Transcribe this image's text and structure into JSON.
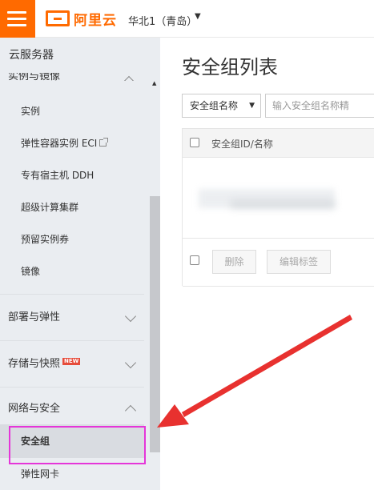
{
  "topbar": {
    "logo_text": "阿里云",
    "region": "华北1（青岛）"
  },
  "sidebar": {
    "title": "云服务器",
    "groups": [
      {
        "label": "实例与镜像",
        "expanded": true,
        "items": [
          {
            "label": "实例"
          },
          {
            "label": "弹性容器实例 ECI",
            "icon": "external-link-icon"
          },
          {
            "label": "专有宿主机 DDH"
          },
          {
            "label": "超级计算集群"
          },
          {
            "label": "预留实例券"
          },
          {
            "label": "镜像"
          }
        ]
      },
      {
        "label": "部署与弹性",
        "expanded": false
      },
      {
        "label": "存储与快照",
        "expanded": false,
        "badge": "NEW"
      },
      {
        "label": "网络与安全",
        "expanded": true,
        "items": [
          {
            "label": "安全组",
            "active": true
          },
          {
            "label": "弹性网卡"
          }
        ]
      }
    ]
  },
  "main": {
    "title": "安全组列表",
    "filter": {
      "selected": "安全组名称",
      "search_placeholder": "输入安全组名称精"
    },
    "table": {
      "columns": [
        "安全组ID/名称"
      ]
    },
    "buttons": {
      "delete": "删除",
      "edit_tags": "编辑标签"
    }
  },
  "annotation": {
    "arrow_color": "#e8312f",
    "highlight_color": "#e536d9"
  },
  "colors": {
    "brand": "#ff6a00",
    "sidebar_bg": "#eaedf1"
  }
}
